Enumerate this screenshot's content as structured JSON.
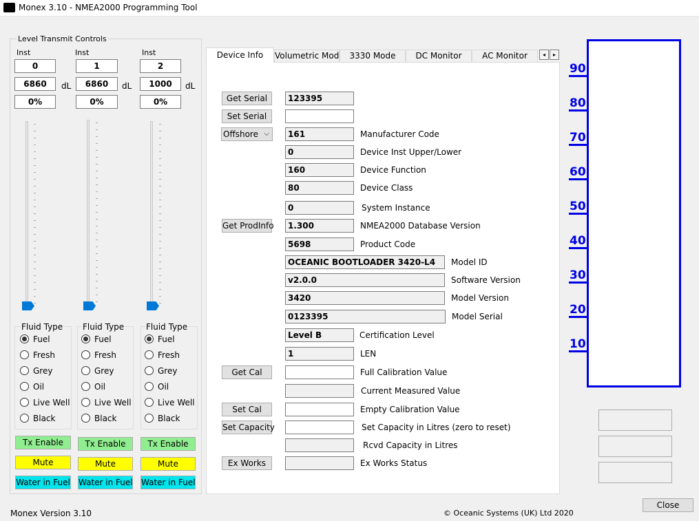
{
  "window": {
    "title": "Monex 3.10 - NMEA2000 Programming Tool"
  },
  "left": {
    "group_title": "Level Transmit Controls",
    "channels": [
      {
        "inst_label": "Inst",
        "inst": "0",
        "level": "6860",
        "unit": "dL",
        "percent": "0%",
        "slider_fraction": 0.0,
        "fluid_title": "Fluid Type",
        "selected": "Fuel",
        "buttons": {
          "tx": "Tx Enable",
          "mute": "Mute",
          "wif": "Water in Fuel"
        }
      },
      {
        "inst_label": "Inst",
        "inst": "1",
        "level": "6860",
        "unit": "dL",
        "percent": "0%",
        "slider_fraction": 0.0,
        "fluid_title": "Fluid Type",
        "selected": "Fuel",
        "buttons": {
          "tx": "Tx Enable",
          "mute": "Mute",
          "wif": "Water in Fuel"
        }
      },
      {
        "inst_label": "Inst",
        "inst": "2",
        "level": "1000",
        "unit": "dL",
        "percent": "0%",
        "slider_fraction": 0.0,
        "fluid_title": "Fluid Type",
        "selected": "Fuel",
        "buttons": {
          "tx": "Tx Enable",
          "mute": "Mute",
          "wif": "Water in Fuel"
        }
      }
    ],
    "fluid_options": [
      "Fuel",
      "Fresh",
      "Grey",
      "Oil",
      "Live Well",
      "Black"
    ],
    "colors": {
      "tx": "#90ee90",
      "mute": "#ffff00",
      "wif": "#00e5ee"
    }
  },
  "tabs": {
    "items": [
      "Device Info",
      "Volumetric Mode",
      "3330 Mode",
      "DC Monitor",
      "AC Monitor"
    ],
    "active": "Device Info",
    "spin_left": "◂",
    "spin_right": "▸"
  },
  "device_info": {
    "get_serial": "Get Serial",
    "serial_value": "123395",
    "set_serial": "Set Serial",
    "set_serial_value": "",
    "profile_select": "Offshore",
    "manufacturer_code": "161",
    "manufacturer_code_label": "Manufacturer Code",
    "device_inst": "0",
    "device_inst_label": "Device Inst Upper/Lower",
    "device_function": "160",
    "device_function_label": "Device Function",
    "device_class": "80",
    "device_class_label": "Device Class",
    "system_instance": "0",
    "system_instance_label": "System Instance",
    "get_prodinfo": "Get ProdInfo",
    "db_version": "1.300",
    "db_version_label": "NMEA2000 Database Version",
    "product_code": "5698",
    "product_code_label": "Product Code",
    "model_id": "OCEANIC BOOTLOADER 3420-L4",
    "model_id_label": "Model ID",
    "software_version": "v2.0.0",
    "software_version_label": "Software Version",
    "model_version": "3420",
    "model_version_label": "Model Version",
    "model_serial": "0123395",
    "model_serial_label": "Model Serial",
    "cert_level": "Level B",
    "cert_level_label": "Certification Level",
    "len": "1",
    "len_label": "LEN",
    "get_cal": "Get Cal",
    "full_cal": "",
    "full_cal_label": "Full Calibration Value",
    "current_measured": "",
    "current_measured_label": "Current Measured Value",
    "set_cal": "Set Cal",
    "empty_cal": "",
    "empty_cal_label": "Empty Calibration Value",
    "set_capacity": "Set Capacity",
    "capacity": "",
    "capacity_label": "Set Capacity in Litres (zero to reset)",
    "rcvd_capacity": "",
    "rcvd_capacity_label": "Rcvd Capacity in Litres",
    "ex_works": "Ex Works",
    "ex_works_status": "",
    "ex_works_status_label": "Ex Works Status"
  },
  "gauge": {
    "ticks": [
      "90",
      "80",
      "70",
      "60",
      "50",
      "40",
      "30",
      "20",
      "10"
    ],
    "level_fraction": 0.0,
    "color": "#0000e6"
  },
  "footer": {
    "version": "Monex Version 3.10",
    "copyright": "© Oceanic Systems (UK) Ltd 2020",
    "close": "Close"
  }
}
